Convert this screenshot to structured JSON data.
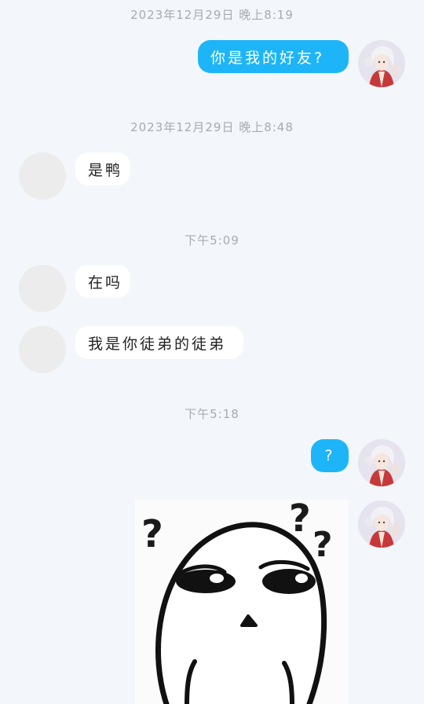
{
  "messages": [
    {
      "type": "timestamp",
      "text": "2023年12月29日 晚上8:19"
    },
    {
      "type": "sent",
      "text": "你是我的好友?",
      "avatar": "user-avatar"
    },
    {
      "type": "timestamp",
      "text": "2023年12月29日 晚上8:48"
    },
    {
      "type": "received",
      "text": "是鸭",
      "avatar": "blank-avatar"
    },
    {
      "type": "timestamp",
      "text": "下午5:09"
    },
    {
      "type": "received",
      "text": "在吗",
      "avatar": "blank-avatar"
    },
    {
      "type": "received",
      "text": "我是你徒弟的徒弟",
      "avatar": "blank-avatar"
    },
    {
      "type": "timestamp",
      "text": "下午5:18"
    },
    {
      "type": "sent",
      "text": "?",
      "avatar": "user-avatar"
    },
    {
      "type": "sent_image",
      "sticker": "confused-face-sticker",
      "avatar": "user-avatar"
    }
  ],
  "colors": {
    "background": "#f3f6fa",
    "sent_bubble": "#1eb5f8",
    "received_bubble": "#ffffff",
    "timestamp": "#a7abb1"
  }
}
